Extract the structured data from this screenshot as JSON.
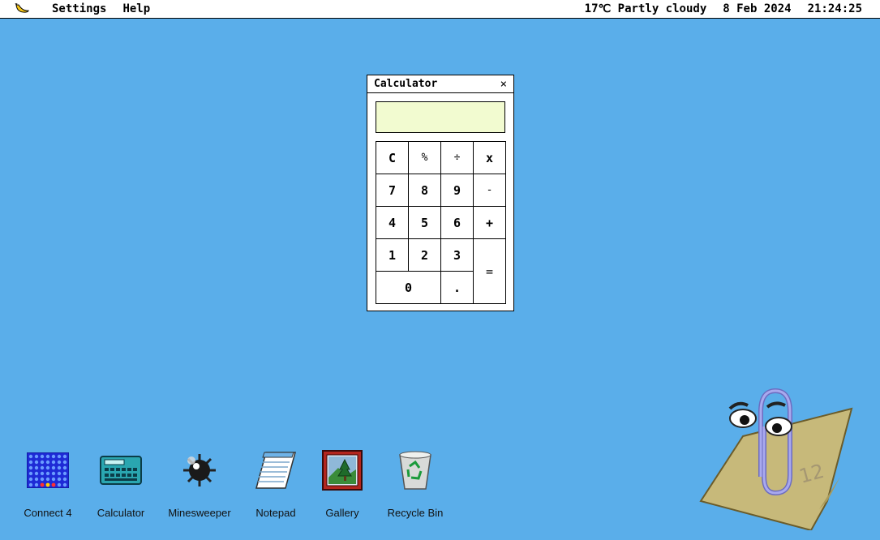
{
  "menubar": {
    "logo_icon": "banana-icon",
    "items": [
      "Settings",
      "Help"
    ],
    "weather": "17℃ Partly cloudy",
    "date": "8 Feb 2024",
    "time": "21:24:25"
  },
  "calculator": {
    "title": "Calculator",
    "close_label": "×",
    "display_value": "",
    "keys": {
      "clear": "C",
      "percent": "%",
      "divide": "÷",
      "multiply": "x",
      "seven": "7",
      "eight": "8",
      "nine": "9",
      "minus": "-",
      "four": "4",
      "five": "5",
      "six": "6",
      "plus": "+",
      "one": "1",
      "two": "2",
      "three": "3",
      "equals": "=",
      "zero": "0",
      "decimal": "."
    }
  },
  "desktop": {
    "icons": [
      {
        "label": "Connect 4",
        "icon": "connect4-icon"
      },
      {
        "label": "Calculator",
        "icon": "calculator-icon"
      },
      {
        "label": "Minesweeper",
        "icon": "mine-icon"
      },
      {
        "label": "Notepad",
        "icon": "notepad-icon"
      },
      {
        "label": "Gallery",
        "icon": "gallery-icon"
      },
      {
        "label": "Recycle Bin",
        "icon": "recycle-bin-icon"
      }
    ]
  },
  "assistant": {
    "icon": "paperclip-assistant-icon"
  },
  "colors": {
    "desktop": "#5aaeea",
    "display": "#f2fbd0"
  }
}
